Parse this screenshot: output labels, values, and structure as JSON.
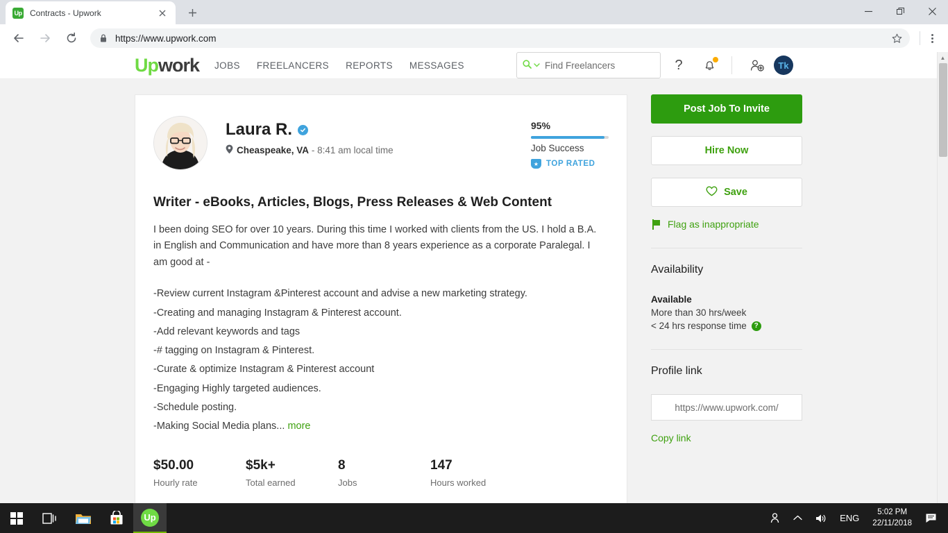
{
  "browser": {
    "tab": {
      "title": "Contracts - Upwork",
      "favicon_text": "Up",
      "close_icon": "close-icon",
      "new_tab_icon": "plus-icon"
    },
    "window_controls": {
      "minimize": "—",
      "restore": "❐",
      "close": "✕"
    },
    "toolbar": {
      "back": "←",
      "forward": "→",
      "reload": "⟳",
      "url": "https://www.upwork.com",
      "lock_icon": "lock-icon",
      "bookmark_icon": "star-icon",
      "menu_icon": "three-dot-menu-icon"
    }
  },
  "site_header": {
    "logo_up": "Up",
    "logo_work": "work",
    "nav": [
      {
        "label": "JOBS"
      },
      {
        "label": "FREELANCERS"
      },
      {
        "label": "REPORTS"
      },
      {
        "label": "MESSAGES"
      }
    ],
    "search": {
      "placeholder": "Find Freelancers",
      "icon": "search-icon",
      "chevron": "chevron-down-icon"
    },
    "help_icon": "question-mark-icon",
    "notifications_icon": "bell-icon",
    "invite_icon": "add-user-icon",
    "avatar_initials": "Tk"
  },
  "profile": {
    "name": "Laura R.",
    "verified_icon": "verified-badge-icon",
    "location_icon": "location-pin-icon",
    "location": "Cheaspeake, VA",
    "local_time": "- 8:41 am local time",
    "job_success_pct": "95%",
    "job_success_value": 95,
    "job_success_label": "Job Success",
    "top_rated_label": "TOP RATED",
    "top_rated_icon": "shield-badge-icon",
    "headline": "Writer - eBooks, Articles, Blogs, Press Releases & Web Content",
    "description": "I been doing SEO for over 10 years. During this time I worked with clients from the US. I hold a B.A. in English and Communication and have more than 8 years experience as a corporate Paralegal. I am good at -",
    "bullets": [
      "-Review current Instagram &Pinterest account and advise a new marketing strategy.",
      "-Creating and managing Instagram & Pinterest account.",
      "-Add relevant keywords and tags",
      "-# tagging on Instagram & Pinterest.",
      "-Curate & optimize Instagram & Pinterest account",
      "-Engaging Highly targeted audiences.",
      "-Schedule posting."
    ],
    "last_bullet": "-Making Social Media plans...",
    "more_label": "more",
    "stats": [
      {
        "value": "$50.00",
        "label": "Hourly rate"
      },
      {
        "value": "$5k+",
        "label": "Total earned"
      },
      {
        "value": "8",
        "label": "Jobs"
      },
      {
        "value": "147",
        "label": "Hours worked"
      }
    ]
  },
  "sidebar": {
    "post_job_label": "Post Job To Invite",
    "hire_now_label": "Hire Now",
    "save_label": "Save",
    "save_icon": "heart-icon",
    "flag_label": "Flag as inappropriate",
    "flag_icon": "flag-icon",
    "availability_title": "Availability",
    "available_status": "Available",
    "hours_per_week": "More than 30 hrs/week",
    "response_time": "< 24 hrs response time",
    "help_icon": "question-circle-icon",
    "profile_link_title": "Profile link",
    "profile_link_value": "https://www.upwork.com/",
    "copy_link_label": "Copy link"
  },
  "taskbar": {
    "start_icon": "windows-start-icon",
    "taskview_icon": "task-view-icon",
    "explorer_icon": "file-explorer-icon",
    "store_icon": "microsoft-store-icon",
    "upwork_icon": "upwork-app-icon",
    "upwork_badge": "Up",
    "people_icon": "people-icon",
    "tray_chevron": "show-hidden-icons-icon",
    "volume_icon": "volume-icon",
    "language": "ENG",
    "time": "5:02 PM",
    "date": "22/11/2018",
    "action_center_icon": "action-center-icon"
  },
  "colors": {
    "upwork_green": "#6fda44",
    "button_green": "#2d9c0f",
    "link_green": "#3fa110",
    "accent_blue": "#3fa3dd",
    "notify_orange": "#fbab00"
  }
}
